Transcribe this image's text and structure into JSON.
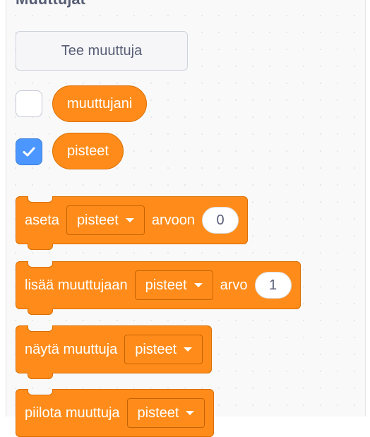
{
  "palette": {
    "heading": "Muuttujat",
    "make_variable_button": "Tee muuttuja",
    "variables": [
      {
        "name": "muuttujani",
        "checked": false
      },
      {
        "name": "pisteet",
        "checked": true
      }
    ],
    "blocks": {
      "set": {
        "label": "aseta",
        "variable": "pisteet",
        "suffix": "arvoon",
        "value": "0"
      },
      "change": {
        "label": "lisää muuttujaan",
        "variable": "pisteet",
        "suffix": "arvo",
        "value": "1"
      },
      "show": {
        "label": "näytä muuttuja",
        "variable": "pisteet"
      },
      "hide": {
        "label": "piilota muuttuja",
        "variable": "pisteet"
      }
    }
  },
  "colors": {
    "variables_block": "#ff8c1a",
    "checkbox_checked": "#4c97ff"
  }
}
